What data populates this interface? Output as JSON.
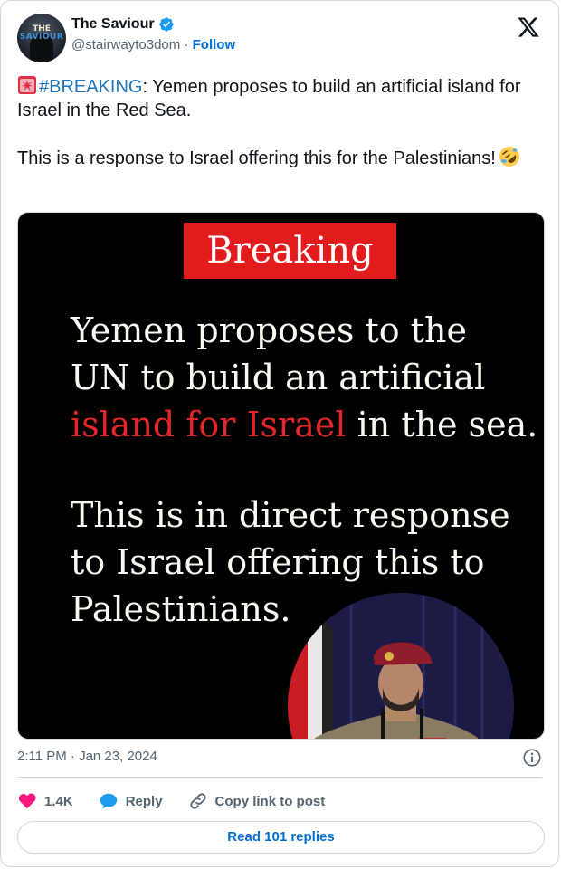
{
  "author": {
    "name": "The Saviour",
    "handle": "@stairwayto3dom",
    "separator": "·",
    "follow_label": "Follow",
    "avatar_text_top": "THE",
    "avatar_text_bottom": "SAVIOUR"
  },
  "tweet": {
    "hashtag": "#BREAKING",
    "line1_rest": ": Yemen proposes to build an artificial island for Israel in the Red Sea.",
    "line2_before_emoji": "This is a response to Israel offering this for the Palestinians!",
    "emoji_icons": [
      "siren-icon",
      "rolling-laughing-icon"
    ]
  },
  "media": {
    "banner": "Breaking",
    "lines": [
      "Yemen proposes to the",
      "UN to build an artificial",
      "in the sea.",
      "This is in direct response",
      "to Israel offering this to",
      "Palestinians."
    ],
    "highlight": "island for Israel",
    "colors": {
      "banner_bg": "#e21b1d",
      "highlight": "#e2262a",
      "background": "#000000"
    }
  },
  "meta": {
    "timestamp": "2:11 PM · Jan 23, 2024"
  },
  "actions": {
    "like_count": "1.4K",
    "reply_label": "Reply",
    "copy_label": "Copy link to post",
    "read_replies_label": "Read 101 replies"
  },
  "colors": {
    "link": "#006fd6",
    "heart": "#f91880",
    "reply": "#1d9bf0",
    "muted": "#536471"
  }
}
